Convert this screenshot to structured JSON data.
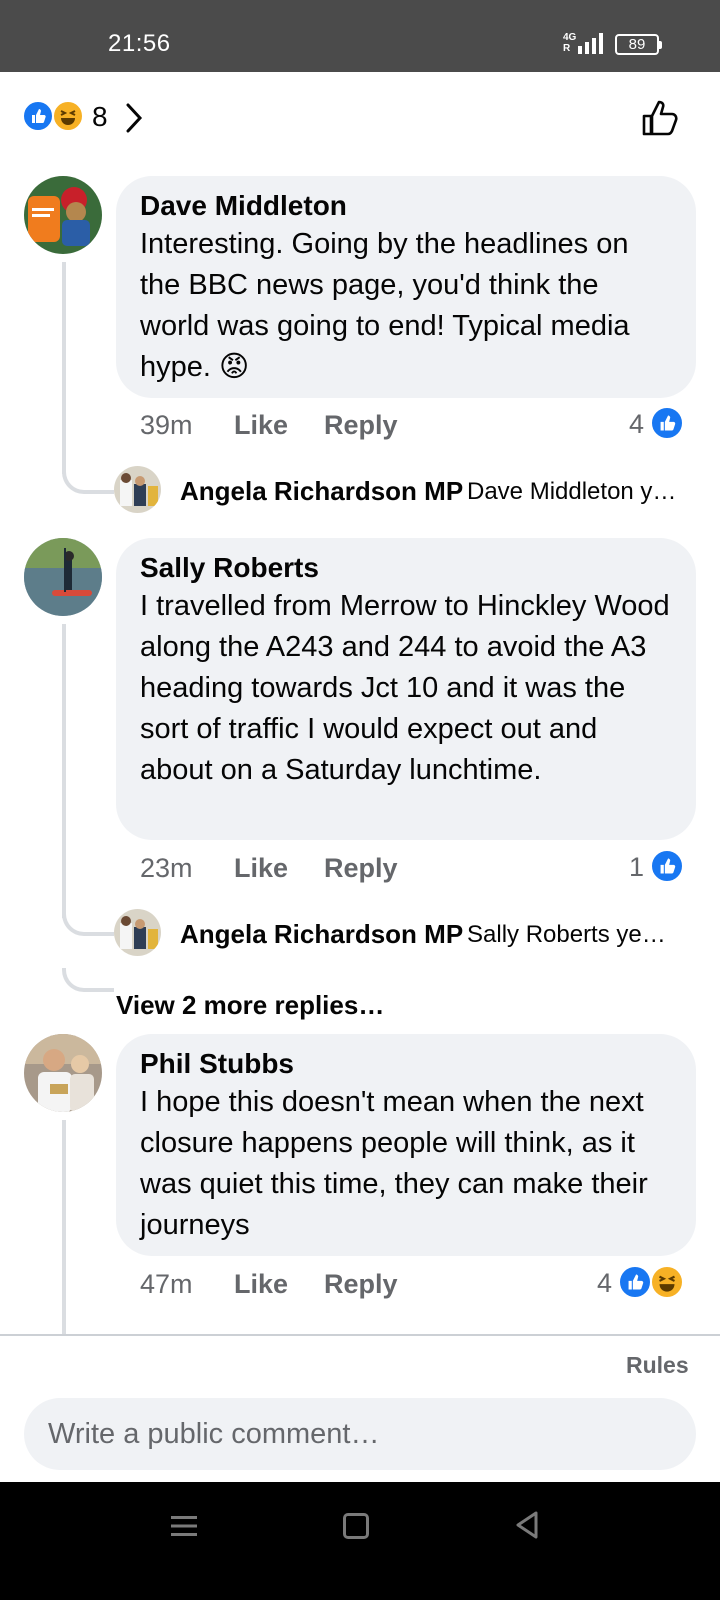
{
  "status_bar": {
    "time": "21:56",
    "network": "4G",
    "battery": "89"
  },
  "reactions_summary": {
    "count": "8"
  },
  "comments": [
    {
      "author": "Dave Middleton",
      "text": "Interesting.  Going by the headlines on the BBC news page, you'd think the world was going to end!  Typical media hype. 😡",
      "time": "39m",
      "like_label": "Like",
      "reply_label": "Reply",
      "reaction_count": "4",
      "reply_preview": {
        "author": "Angela Richardson MP",
        "text": "Dave Middleton y…"
      }
    },
    {
      "author": "Sally Roberts",
      "text": "I travelled from Merrow to Hinckley Wood along the A243 and 244 to avoid the A3 heading towards Jct 10 and it was the sort of traffic I would expect out and about on a Saturday lunchtime.",
      "time": "23m",
      "like_label": "Like",
      "reply_label": "Reply",
      "reaction_count": "1",
      "reply_preview": {
        "author": "Angela Richardson MP",
        "text": "Sally Roberts yes…"
      },
      "view_more": "View 2 more replies…"
    },
    {
      "author": "Phil Stubbs",
      "text": "I hope this doesn't mean when the next closure happens people will think, as it was quiet this time, they can make their journeys",
      "time": "47m",
      "like_label": "Like",
      "reply_label": "Reply",
      "reaction_count": "4"
    }
  ],
  "footer": {
    "rules_label": "Rules",
    "comment_placeholder": "Write a public comment…"
  },
  "colors": {
    "accent": "#1877f2",
    "bubble": "#f0f2f5",
    "muted": "#65676b",
    "status_bar": "#4b4b4b"
  }
}
